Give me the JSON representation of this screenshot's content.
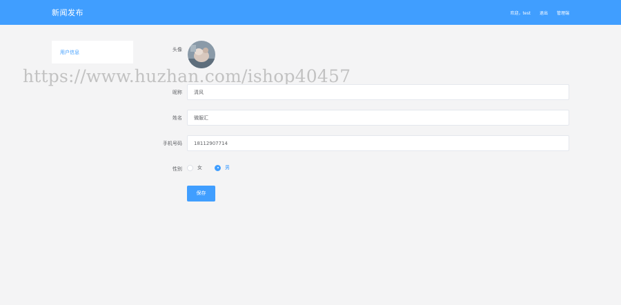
{
  "header": {
    "brand": "新闻发布",
    "nav": [
      "欢迎，test",
      "退出",
      "管理端"
    ]
  },
  "sidebar": {
    "items": [
      {
        "label": "用户信息"
      }
    ]
  },
  "form": {
    "avatar_label": "头像",
    "nickname": {
      "label": "昵称",
      "value": "清风"
    },
    "name": {
      "label": "姓名",
      "value": "微服汇"
    },
    "phone": {
      "label": "手机号码",
      "value": "18112907714"
    },
    "gender": {
      "label": "性别",
      "options": [
        "女",
        "男"
      ],
      "selected": "男"
    },
    "save_label": "保存"
  },
  "watermark": "https://www.huzhan.com/ishop40457",
  "colors": {
    "primary": "#409eff",
    "background": "#f4f4f5"
  }
}
